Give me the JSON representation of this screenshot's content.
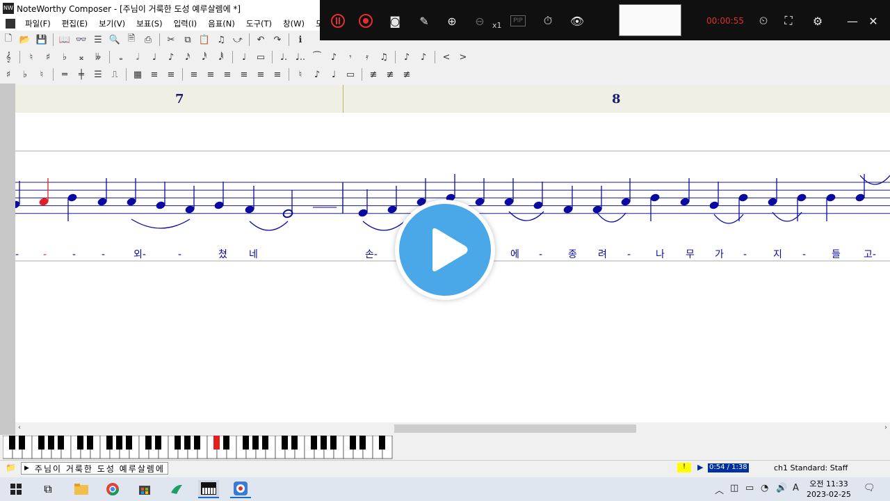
{
  "window": {
    "title": "NoteWorthy Composer - [주님이 거룩한 도성 예루살렘에 *]",
    "app_icon": "noteworthy-app-icon"
  },
  "menu": {
    "items": [
      "파일(F)",
      "편집(E)",
      "보기(V)",
      "보표(S)",
      "입력(I)",
      "음표(N)",
      "도구(T)",
      "창(W)",
      "도움말(H"
    ]
  },
  "score": {
    "measures": [
      "7",
      "8"
    ],
    "lyrics": [
      "-",
      "-",
      "-",
      "-",
      "외-",
      "-",
      "쳤",
      "네",
      "손-",
      "에",
      "-",
      "종",
      "려",
      "-",
      "나",
      "무",
      "가",
      "-",
      "지",
      "-",
      "들",
      "고-"
    ],
    "staff_color": "#1a1a8c",
    "note_color": "#0a0aa0",
    "highlight_color": "#e02020"
  },
  "status": {
    "document_tab": "주님이 거룩한 도성 예루살렘에",
    "warning": "!",
    "playback_time": "0:54 / 1:38",
    "staff_label": "ch1 Standard: Staff"
  },
  "recorder": {
    "timer": "00:00:55",
    "zoom_label": "x1",
    "pip_label": "PIP"
  },
  "taskbar": {
    "time": "오전 11:33",
    "date": "2023-02-25",
    "input_indicator": "A"
  }
}
